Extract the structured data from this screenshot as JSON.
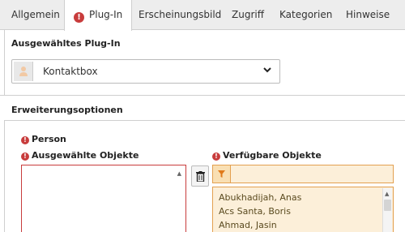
{
  "tabs": [
    {
      "label": "Allgemein",
      "active": false
    },
    {
      "label": "Plug-In",
      "active": true,
      "error_icon": "exclamation-icon"
    },
    {
      "label": "Erscheinungsbild",
      "active": false
    },
    {
      "label": "Zugriff",
      "active": false
    },
    {
      "label": "Kategorien",
      "active": false
    },
    {
      "label": "Hinweise",
      "active": false
    }
  ],
  "plugin_section": {
    "heading": "Ausgewähltes Plug-In",
    "select": {
      "value": "Kontaktbox",
      "icon": "person-avatar-icon"
    }
  },
  "options_section": {
    "heading": "Erweiterungsoptionen",
    "person_label": "Person",
    "selected_label": "Ausgewählte Objekte",
    "available_label": "Verfügbare Objekte",
    "filter_value": "",
    "available_items": [
      "Abukhadijah, Anas",
      "Acs Santa, Boris",
      "Ahmad, Jasin"
    ]
  },
  "colors": {
    "error": "#c83c3c",
    "warning_border": "#e3a050",
    "warning_bg": "#fcefd9"
  }
}
